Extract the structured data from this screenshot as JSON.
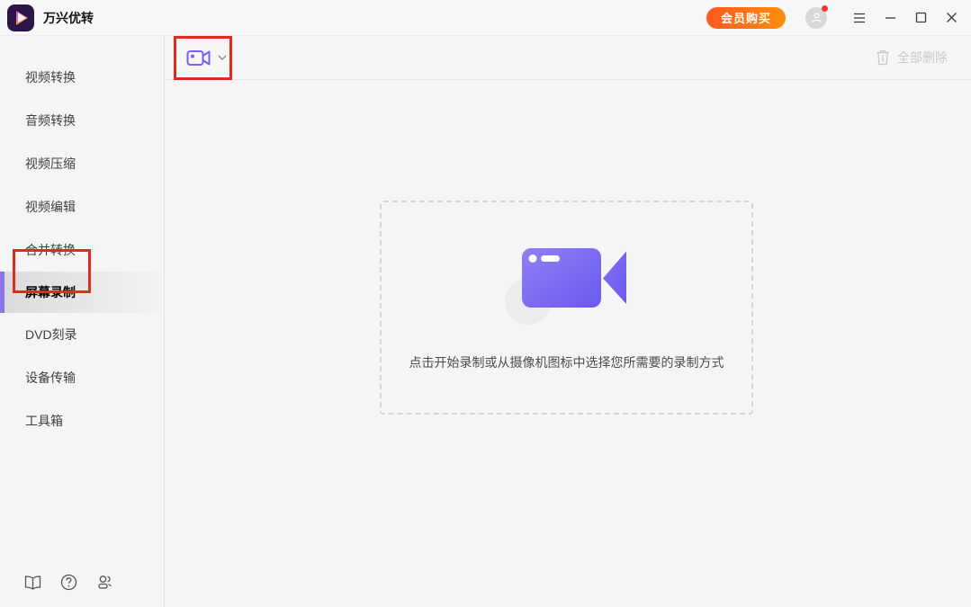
{
  "window": {
    "title": "万兴优转",
    "buy_button_label": "会员购买",
    "controls": {
      "menu_icon": "hamburger-menu-icon",
      "minimize_icon": "minimize-icon",
      "maximize_icon": "maximize-icon",
      "close_icon": "close-icon"
    },
    "avatar": {
      "icon": "user-avatar-icon",
      "has_notification_dot": true
    }
  },
  "sidebar": {
    "items": [
      {
        "label": "视频转换",
        "selected": false
      },
      {
        "label": "音频转换",
        "selected": false
      },
      {
        "label": "视频压缩",
        "selected": false
      },
      {
        "label": "视频编辑",
        "selected": false
      },
      {
        "label": "合并转换",
        "selected": false
      },
      {
        "label": "屏幕录制",
        "selected": true
      },
      {
        "label": "DVD刻录",
        "selected": false
      },
      {
        "label": "设备传输",
        "selected": false
      },
      {
        "label": "工具箱",
        "selected": false
      }
    ],
    "footer_icons": [
      "guide-book-icon",
      "help-icon",
      "contact-icon"
    ]
  },
  "toolbar": {
    "record_mode_icon": "video-camera-icon",
    "record_mode_dropdown_icon": "chevron-down-icon",
    "delete_all_label": "全部删除",
    "delete_all_icon": "trash-icon",
    "delete_all_enabled": false
  },
  "main": {
    "empty_state_icon": "video-camera-illustration",
    "hint": "点击开始录制或从摄像机图标中选择您所需要的录制方式"
  },
  "annotations": [
    {
      "name": "red-box-camera-dropdown",
      "target": "toolbar camera dropdown"
    },
    {
      "name": "red-box-screen-record",
      "target": "sidebar item 屏幕录制"
    }
  ],
  "colors": {
    "accent_purple": "#7c5ff0",
    "selected_bar_purple": "#8a74e8",
    "buy_gradient": [
      "#ff5a1e",
      "#ff8e0c"
    ],
    "annotation_red": "#e7281d",
    "disabled_gray": "#c9c9c9",
    "camera_gradient": [
      "#9181f2",
      "#6a58f0"
    ],
    "background": "#f5f5f6"
  }
}
